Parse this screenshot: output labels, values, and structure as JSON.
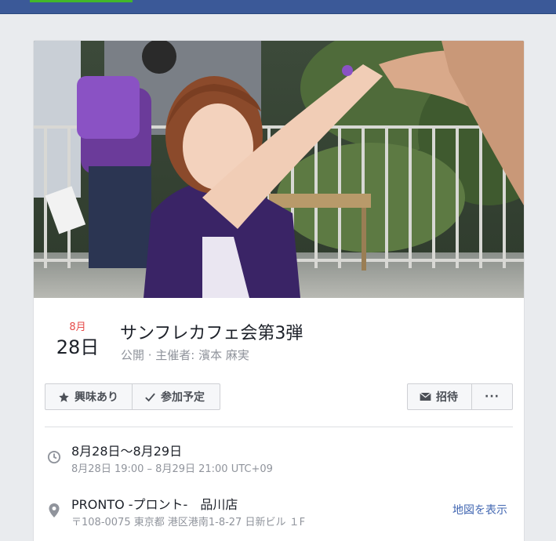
{
  "event": {
    "month": "8月",
    "day": "28日",
    "title": "サンフレカフェ会第3弾",
    "subtitle": "公開 · 主催者: 濱本 麻実"
  },
  "actions": {
    "interested_label": "興味あり",
    "going_label": "参加予定",
    "invite_label": "招待",
    "more_label": "···"
  },
  "details": {
    "date_range": "8月28日～8月29日",
    "time_range": "8月28日 19:00 – 8月29日 21:00 UTC+09",
    "venue": "PRONTO -プロント-　品川店",
    "address": "〒108-0075 東京都 港区港南1-8-27 日新ビル １F",
    "map_link": "地図を表示"
  },
  "icons": {
    "interested": "star-icon",
    "going": "checkmark-icon",
    "invite": "envelope-icon",
    "time": "clock-icon",
    "location": "map-pin-icon"
  },
  "colors": {
    "header": "#3b5998",
    "accent_green": "#42b72a",
    "month_red": "#e64a48",
    "link_blue": "#4267b2"
  }
}
